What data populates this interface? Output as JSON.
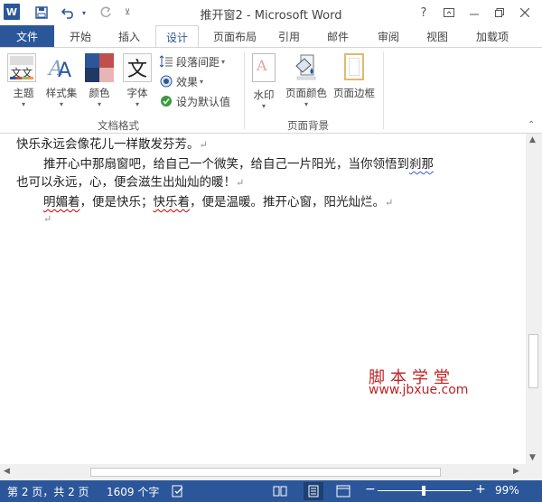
{
  "title": "推开窗2 - Microsoft Word",
  "qat": {
    "word_icon": "W",
    "save_icon": "floppy-disk-icon",
    "undo_icon": "undo-icon",
    "redo_icon": "redo-icon"
  },
  "window_buttons": {
    "help": "?",
    "ribbon_options": "▭",
    "minimize": "—",
    "restore": "☐",
    "close": "✕"
  },
  "tabs": [
    "文件",
    "开始",
    "插入",
    "设计",
    "页面布局",
    "引用",
    "邮件",
    "审阅",
    "视图",
    "加载项"
  ],
  "active_tab": "设计",
  "ribbon": {
    "theme": "主题",
    "style_set": "样式集",
    "colors": "颜色",
    "fonts": "字体",
    "paragraph_spacing": "段落间距",
    "effects": "效果",
    "set_default": "设为默认值",
    "group1": "文档格式",
    "watermark": "水印",
    "page_color": "页面颜色",
    "page_borders": "页面边框",
    "group2": "页面背景",
    "font_icon_text": "文",
    "theme_icon_text": "文文"
  },
  "document": {
    "line1": "快乐永远会像花儿一样散发芬芳。",
    "line2a": "推开心中那扇窗吧，给自己一个微笑，给自己一片阳光，当你领悟到",
    "line2b": "刹那",
    "line3": "也可以永远，心，便会滋生出灿灿的暖！",
    "line4a": "明媚着",
    "line4b": "，便是快乐；",
    "line4c": "快乐着",
    "line4d": "，便是温暖。推开心窗，阳光灿烂。",
    "para_mark": "↵"
  },
  "watermark": {
    "line1": "脚本学堂",
    "line2": "www.jbxue.com"
  },
  "status": {
    "page": "第 2 页，共 2 页",
    "words": "1609 个字",
    "zoom": "99%",
    "zoom_minus": "−",
    "zoom_plus": "+"
  }
}
